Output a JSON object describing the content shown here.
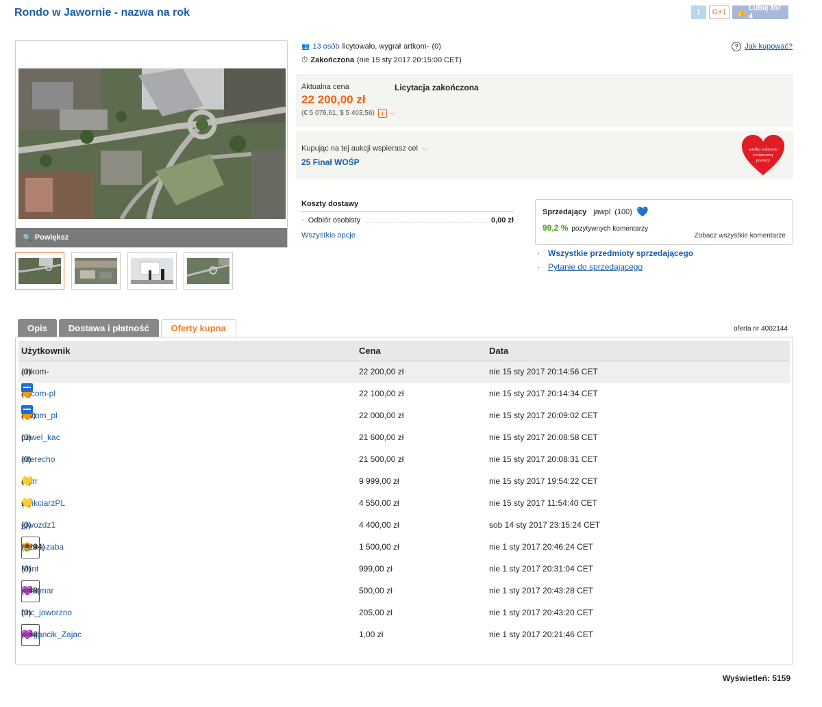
{
  "title": "Rondo w Jawornie - nazwa na rok",
  "social": {
    "twitter": "t",
    "gplus": "G+1",
    "fb_like": "Lubię to! 4"
  },
  "gallery": {
    "zoom_label": "Powiększ"
  },
  "auction": {
    "bidders_count": "13 osób",
    "bid_text": "licytowało, wygrał",
    "winner": "artkom-",
    "winner_score": "(0)",
    "status": "Zakończona",
    "end_date": "(nie 15 sty 2017 20:15:00 CET)",
    "how_to_buy": "Jak kupować?"
  },
  "price": {
    "label": "Aktualna cena",
    "status": "Licytacja zakończona",
    "value": "22 200,00 zł",
    "conversion": "(€ 5 076,61, $ 5 403,56)"
  },
  "charity": {
    "label": "Kupując na tej aukcji wspierasz cel",
    "cause": "25 Finał WOŚP",
    "logo_text": "wielka orkiestra świątecznej pomocy"
  },
  "shipping": {
    "header": "Koszty dostawy",
    "option": "Odbiór osobisty",
    "option_price": "0,00 zł",
    "all_options": "Wszystkie opcje"
  },
  "seller": {
    "label": "Sprzedający",
    "name": "jawpl",
    "score": "(100)",
    "positive_pct": "99,2 %",
    "positive_text": "pozytywnych komentarzy",
    "all_comments": "Zobacz wszystkie komentarze",
    "link_all_items": "Wszystkie przedmioty sprzedającego",
    "link_question": "Pytanie do sprzedającego"
  },
  "tabs": [
    {
      "label": "Opis"
    },
    {
      "label": "Dostawa i płatność"
    },
    {
      "label": "Oferty kupna"
    }
  ],
  "offer_number": "oferta nr 4002144",
  "table": {
    "headers": [
      "Użytkownik",
      "Cena",
      "Data"
    ],
    "rows": [
      {
        "user": "artkom-",
        "score": "(0)",
        "price": "22 200,00 zł",
        "date": "nie 15 sty 2017 20:14:56 CET",
        "badges": []
      },
      {
        "user": "artcom-pl",
        "score": "(5)",
        "price": "22 100,00 zł",
        "date": "nie 15 sty 2017 20:14:34 CET",
        "badges": [
          "orange-heart",
          "briefcase"
        ]
      },
      {
        "user": "artcom_pl",
        "score": "(10)",
        "price": "22 000,00 zł",
        "date": "nie 15 sty 2017 20:09:02 CET",
        "badges": [
          "orange-heart",
          "briefcase"
        ]
      },
      {
        "user": "pawel_kac",
        "score": "(0)",
        "price": "21 600,00 zł",
        "date": "nie 15 sty 2017 20:08:58 CET",
        "badges": []
      },
      {
        "user": "interecho",
        "score": "(0)",
        "price": "21 500,00 zł",
        "date": "nie 15 sty 2017 20:08:31 CET",
        "badges": []
      },
      {
        "user": "aairr",
        "score": "(1)",
        "price": "9 999,00 zł",
        "date": "nie 15 sty 2017 19:54:22 CET",
        "badges": [
          "yellow-heart"
        ]
      },
      {
        "user": "CinkciarzPL",
        "score": "(2)",
        "price": "4 550,00 zł",
        "date": "nie 15 sty 2017 11:54:40 CET",
        "badges": [
          "yellow-heart"
        ]
      },
      {
        "user": "jgwozdz1",
        "score": "(0)",
        "price": "4 400,00 zł",
        "date": "sob 14 sty 2017 23:15:24 CET",
        "badges": []
      },
      {
        "user": "ifonka-zaba",
        "score": "(1294)",
        "price": "1 500,00 zł",
        "date": "nie 1 sty 2017 20:46:24 CET",
        "badges": [
          "sunflower",
          "o-mnie"
        ]
      },
      {
        "user": "Miint",
        "score": "(0)",
        "price": "999,00 zł",
        "date": "nie 1 sty 2017 20:31:04 CET",
        "badges": []
      },
      {
        "user": "dudamar",
        "score": "(443)",
        "price": "500,00 zł",
        "date": "nie 1 sty 2017 20:43:28 CET",
        "badges": [
          "purple-heart",
          "o-mnie"
        ]
      },
      {
        "user": "bnc_jaworzno",
        "score": "(0)",
        "price": "205,00 zł",
        "date": "nie 1 sty 2017 20:43:20 CET",
        "badges": []
      },
      {
        "user": "Elegancik_Zajac",
        "score": "(382)",
        "price": "1,00 zł",
        "date": "nie 1 sty 2017 20:21:46 CET",
        "badges": [
          "purple-heart",
          "o-mnie"
        ]
      }
    ]
  },
  "badge_omnie_text": "o mnie",
  "views": "Wyświetleń: 5159",
  "colors": {
    "link": "#1a5ba6",
    "price": "#f5610f",
    "accent": "#f57a20",
    "positive": "#47a416"
  }
}
